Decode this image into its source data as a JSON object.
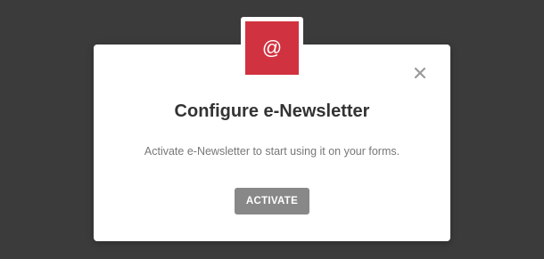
{
  "modal": {
    "icon_glyph": "@",
    "icon_name": "at-sign-icon",
    "accent_color": "#d1323f",
    "close_icon": "close-icon",
    "title": "Configure e-Newsletter",
    "description": "Activate e-Newsletter to start using it on your forms.",
    "activate_label": "ACTIVATE"
  },
  "colors": {
    "backdrop": "#3b3b3b",
    "button": "#888888"
  }
}
